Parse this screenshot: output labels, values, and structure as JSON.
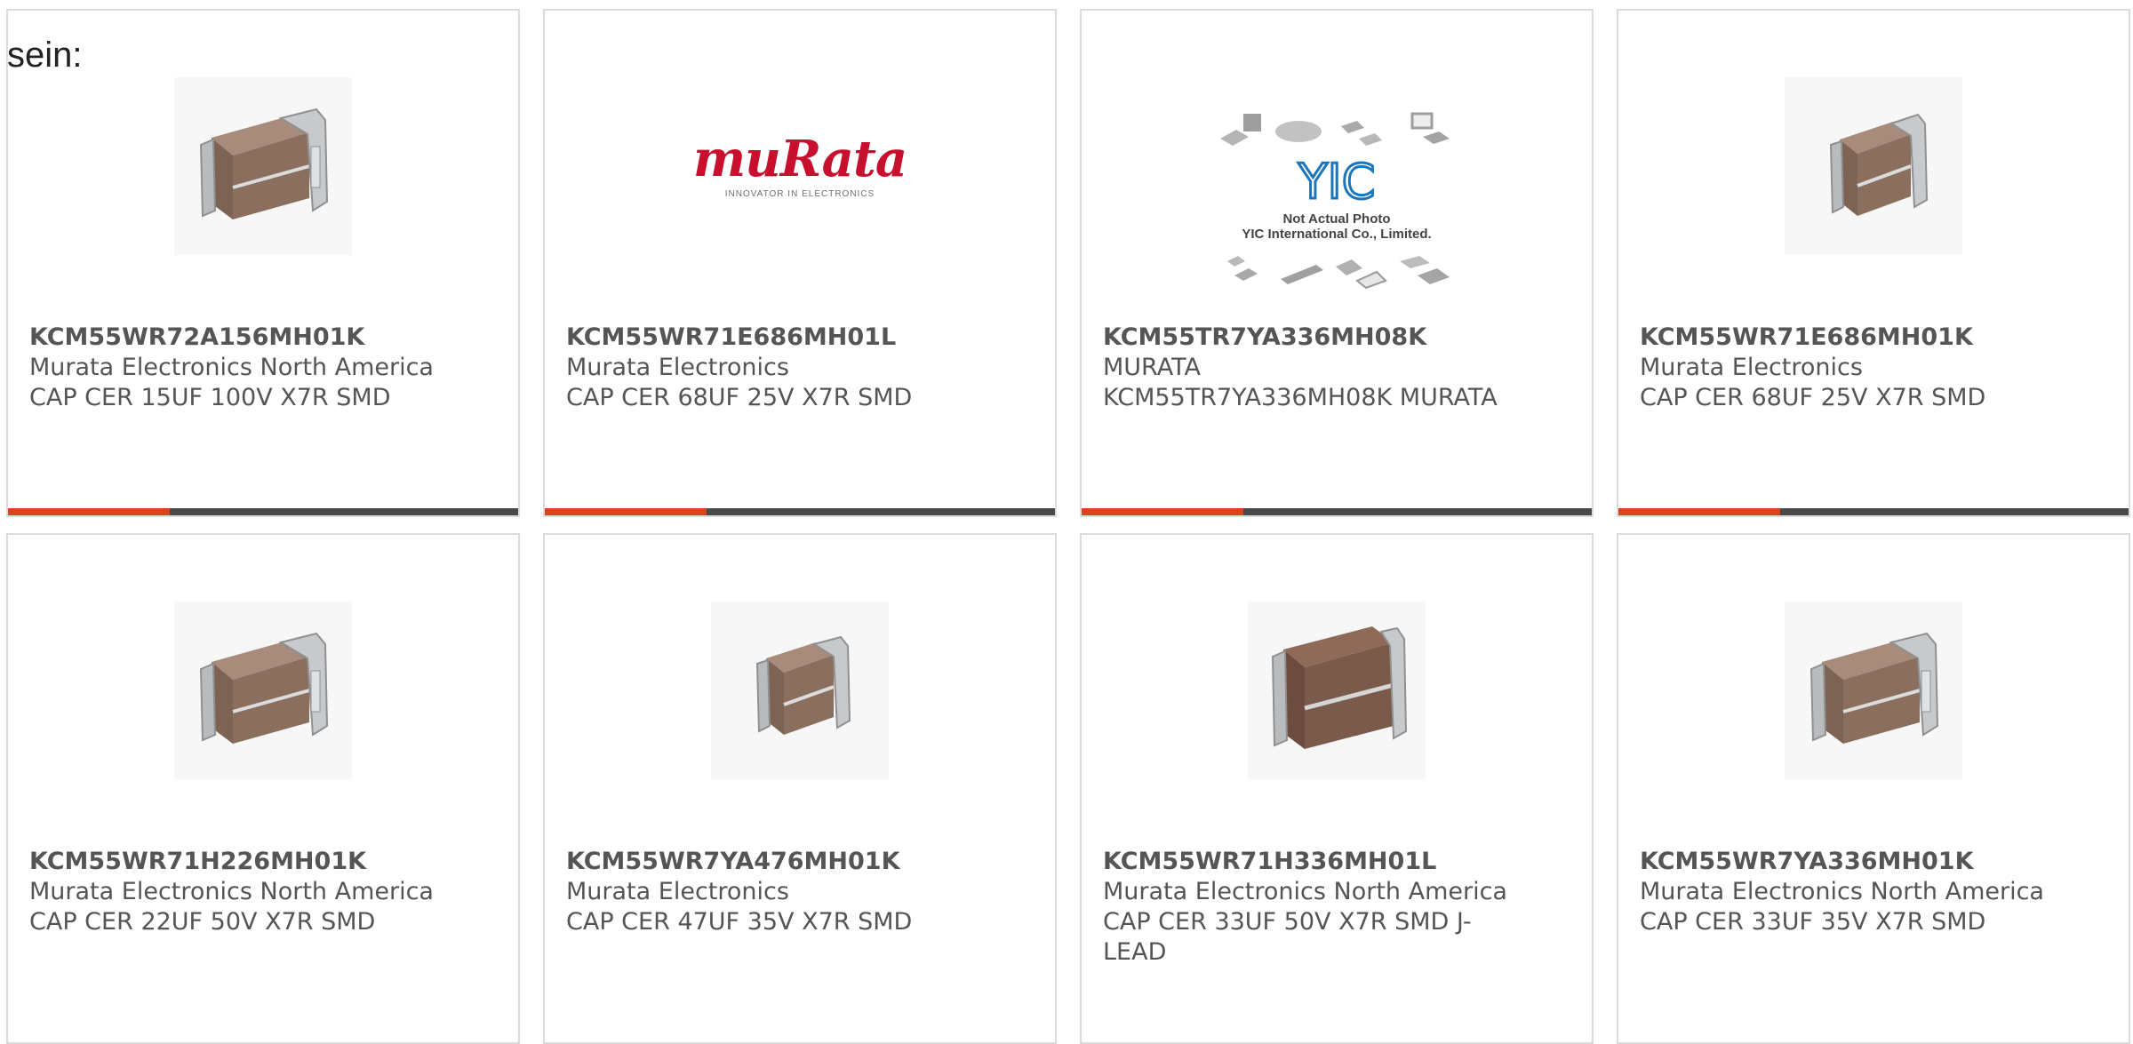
{
  "intro_text": "sein:",
  "colors": {
    "accent": "#d9441c",
    "bar": "#4a4a4a",
    "border": "#dcdcdc",
    "text": "#555555"
  },
  "products": [
    {
      "part_number": "KCM55WR72A156MH01K",
      "manufacturer": "Murata Electronics North America",
      "description": "CAP CER 15UF 100V X7R SMD",
      "image": "capacitor-photo"
    },
    {
      "part_number": "KCM55WR71E686MH01L",
      "manufacturer": "Murata Electronics",
      "description": "CAP CER 68UF 25V X7R SMD",
      "image": "murata-logo",
      "logo_text": "muRata",
      "logo_tagline": "INNOVATOR IN ELECTRONICS"
    },
    {
      "part_number": "KCM55TR7YA336MH08K",
      "manufacturer": "MURATA",
      "description": "KCM55TR7YA336MH08K MURATA",
      "image": "yic-placeholder",
      "placeholder_logo": "YIC",
      "placeholder_line1": "Not Actual Photo",
      "placeholder_line2": "YIC International Co., Limited."
    },
    {
      "part_number": "KCM55WR71E686MH01K",
      "manufacturer": "Murata Electronics",
      "description": "CAP CER 68UF 25V X7R SMD",
      "image": "capacitor-photo"
    },
    {
      "part_number": "KCM55WR71H226MH01K",
      "manufacturer": "Murata Electronics North America",
      "description": "CAP CER 22UF 50V X7R SMD",
      "image": "capacitor-photo"
    },
    {
      "part_number": "KCM55WR7YA476MH01K",
      "manufacturer": "Murata Electronics",
      "description": "CAP CER 47UF 35V X7R SMD",
      "image": "capacitor-photo"
    },
    {
      "part_number": "KCM55WR71H336MH01L",
      "manufacturer": "Murata Electronics North America",
      "description": "CAP CER 33UF 50V X7R SMD J-LEAD",
      "image": "capacitor-photo"
    },
    {
      "part_number": "KCM55WR7YA336MH01K",
      "manufacturer": "Murata Electronics North America",
      "description": "CAP CER 33UF 35V X7R SMD",
      "image": "capacitor-photo"
    }
  ]
}
